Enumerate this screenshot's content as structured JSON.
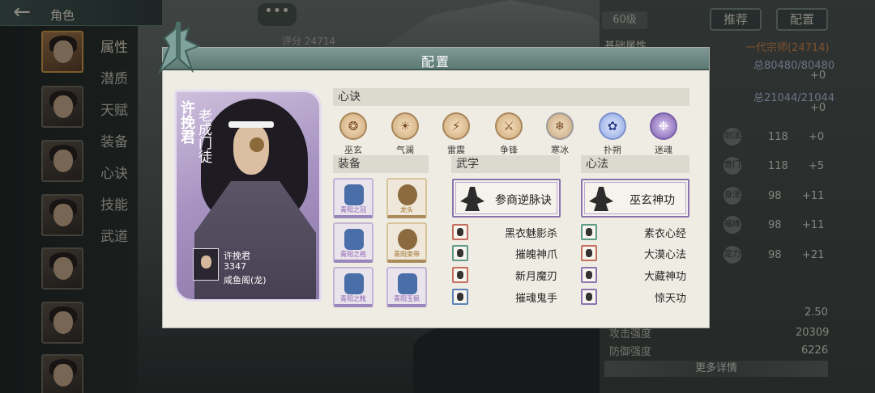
{
  "topbar": {
    "title": "角色"
  },
  "sidebar": {
    "tabs": [
      "属性",
      "潜质",
      "天赋",
      "装备",
      "心诀",
      "技能",
      "武道"
    ]
  },
  "background": {
    "chat_icon": "•••",
    "score": "评分 24714",
    "level": "60级",
    "recommend_label": "推荐",
    "config_label": "配置",
    "base_attr_title": "基础属性",
    "rank": "一代宗师(24714)",
    "hp_value": "总80480/80480",
    "hp_plus": "+0",
    "mp_value": "总21044/21044",
    "mp_plus": "+0",
    "stats": [
      {
        "icon": "剑法",
        "value": "118",
        "bonus": "+0"
      },
      {
        "icon": "奇门",
        "value": "118",
        "bonus": "+5"
      },
      {
        "icon": "身法",
        "value": "98",
        "bonus": "+11"
      },
      {
        "icon": "福缘",
        "value": "98",
        "bonus": "+11"
      },
      {
        "icon": "定力",
        "value": "98",
        "bonus": "+21"
      }
    ],
    "speed_value": "2.50",
    "attack_label": "攻击强度",
    "attack_value": "20309",
    "defense_label": "防御强度",
    "defense_value": "6226",
    "more_details": "更多详情"
  },
  "modal": {
    "title": "配置",
    "card": {
      "name": "许挽君",
      "tag": "老成门徒",
      "player_name": "许挽君",
      "player_id": "3347",
      "guild": "咸鱼阁(龙)"
    },
    "heart_section": "心诀",
    "heart_items": [
      {
        "label": "巫玄",
        "glyph": "❂",
        "style": ""
      },
      {
        "label": "气澜",
        "glyph": "☀",
        "style": ""
      },
      {
        "label": "雷震",
        "glyph": "⚡",
        "style": ""
      },
      {
        "label": "争锋",
        "glyph": "⚔",
        "style": ""
      },
      {
        "label": "寒冰",
        "glyph": "❄",
        "style": "ice"
      },
      {
        "label": "扑朔",
        "glyph": "✿",
        "style": "blue"
      },
      {
        "label": "迷魂",
        "glyph": "❉",
        "style": "purple"
      }
    ],
    "equip_section": "装备",
    "equipment": [
      {
        "label": "青阳之冠",
        "style": ""
      },
      {
        "label": "龙头",
        "style": "gold"
      },
      {
        "label": "青阳之袍",
        "style": ""
      },
      {
        "label": "青阳束带",
        "style": "gold"
      },
      {
        "label": "青阳之靴",
        "style": ""
      },
      {
        "label": "青阳玉佩",
        "style": ""
      }
    ],
    "martial_section": "武学",
    "martial_featured": "参商逆脉诀",
    "martial_list": [
      {
        "name": "黑衣魅影杀",
        "style": ""
      },
      {
        "name": "摧魄神爪",
        "style": "green"
      },
      {
        "name": "新月魔刃",
        "style": ""
      },
      {
        "name": "摧魂鬼手",
        "style": "blue"
      }
    ],
    "mind_section": "心法",
    "mind_featured": "巫玄神功",
    "mind_list": [
      {
        "name": "素衣心经",
        "style": "green"
      },
      {
        "name": "大漠心法",
        "style": ""
      },
      {
        "name": "大藏神功",
        "style": "purple"
      },
      {
        "name": "惊天功",
        "style": "purple"
      }
    ]
  },
  "colors": {
    "header_teal": "#6e8985",
    "panel_bg": "#efece3",
    "card_purple": "#a894c2",
    "accent_orange": "#e28b4a"
  }
}
